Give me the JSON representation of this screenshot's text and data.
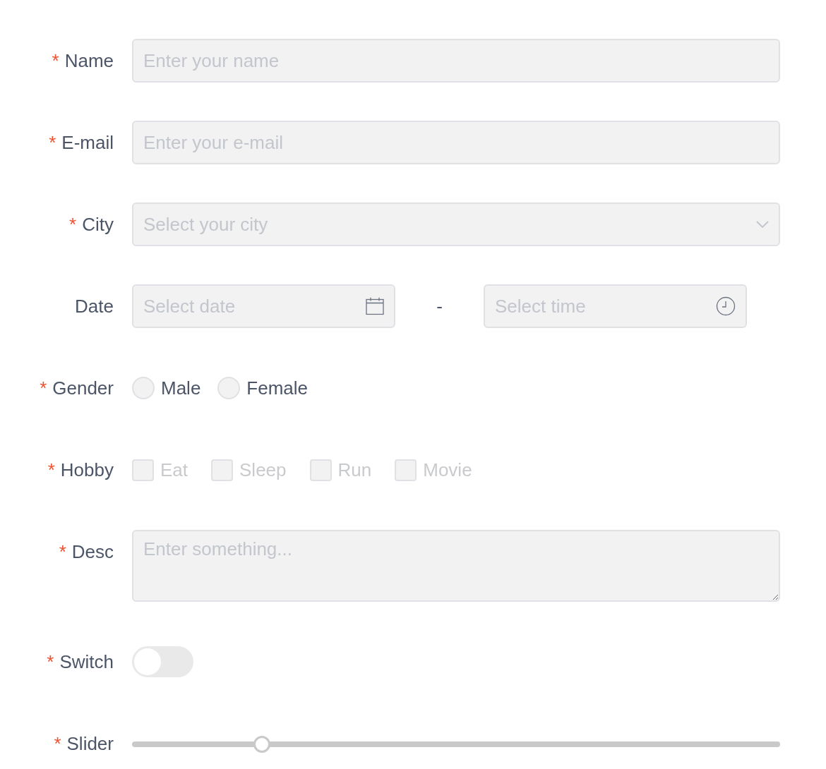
{
  "fields": [
    {
      "kind": "text",
      "required_mark": "*",
      "label": "Name",
      "placeholder": "Enter your name"
    },
    {
      "kind": "text",
      "required_mark": "*",
      "label": "E-mail",
      "placeholder": "Enter your e-mail"
    },
    {
      "kind": "select",
      "required_mark": "*",
      "label": "City",
      "placeholder": "Select your city"
    },
    {
      "kind": "datetime",
      "label": "Date",
      "date_placeholder": "Select date",
      "separator": "-",
      "time_placeholder": "Select time"
    },
    {
      "kind": "radio",
      "required_mark": "*",
      "label": "Gender",
      "options": [
        {
          "label": "Male",
          "selected": false
        },
        {
          "label": "Female",
          "selected": false
        }
      ]
    },
    {
      "kind": "checkbox",
      "required_mark": "*",
      "label": "Hobby",
      "disabled": true,
      "options": [
        {
          "label": "Eat",
          "checked": false
        },
        {
          "label": "Sleep",
          "checked": false
        },
        {
          "label": "Run",
          "checked": false
        },
        {
          "label": "Movie",
          "checked": false
        }
      ]
    },
    {
      "kind": "textarea",
      "required_mark": "*",
      "label": "Desc",
      "placeholder": "Enter something..."
    },
    {
      "kind": "switch",
      "required_mark": "*",
      "label": "Switch",
      "on": false
    },
    {
      "kind": "slider",
      "required_mark": "*",
      "label": "Slider",
      "level": 0.2
    }
  ]
}
